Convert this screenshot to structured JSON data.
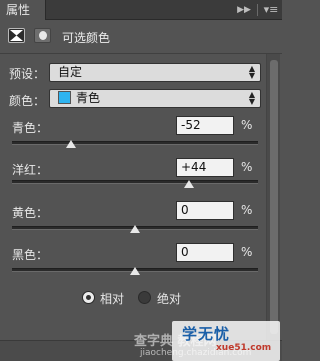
{
  "tabbar": {
    "title": "属性",
    "collapse_icon": "double-chevron-right-icon",
    "menu_icon": "panel-menu-icon"
  },
  "header": {
    "title": "可选颜色",
    "adjustment_icon": "selective-color-icon",
    "mask_icon": "layer-mask-icon"
  },
  "preset": {
    "label": "预设：",
    "value": "自定"
  },
  "colors": {
    "label": "颜色：",
    "value": "青色",
    "swatch_color": "#2fb4f0"
  },
  "sliders": [
    {
      "label": "青色：",
      "value": "-52",
      "unit": "%",
      "amount": -52
    },
    {
      "label": "洋红：",
      "value": "+44",
      "unit": "%",
      "amount": 44
    },
    {
      "label": "黄色：",
      "value": "0",
      "unit": "%",
      "amount": 0
    },
    {
      "label": "黑色：",
      "value": "0",
      "unit": "%",
      "amount": 0
    }
  ],
  "method": {
    "options": [
      {
        "label": "相对",
        "checked": true
      },
      {
        "label": "绝对",
        "checked": false
      }
    ]
  },
  "watermark": {
    "main": "学无忧",
    "site": "xue51.com",
    "overlay": "查字典 教程网",
    "url": "jiaocheng.chazidian.com"
  }
}
